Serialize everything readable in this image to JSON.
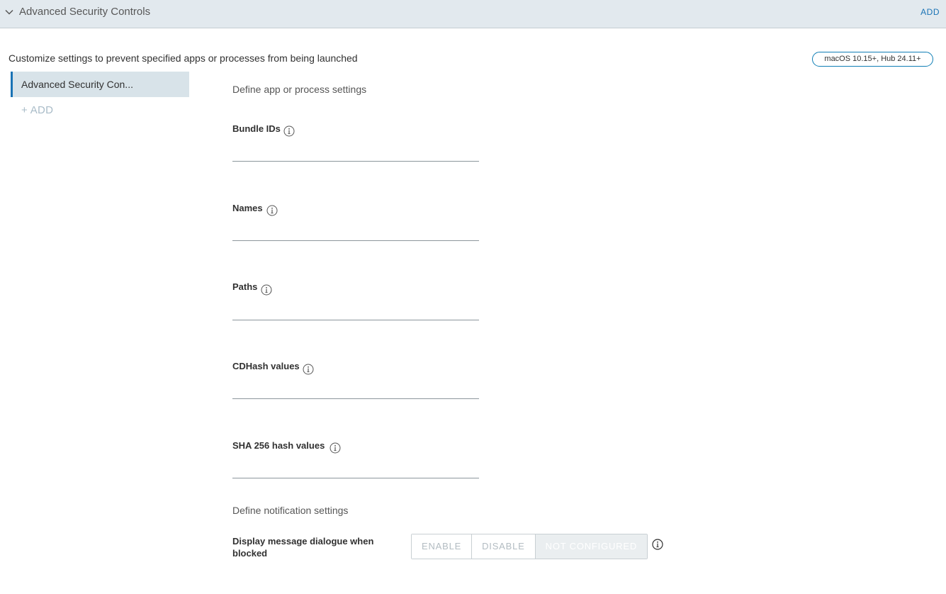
{
  "header": {
    "title": "Advanced Security Controls",
    "add_label": "ADD"
  },
  "description": "Customize settings to prevent specified apps or processes from being launched",
  "version_badge": "macOS 10.15+, Hub 24.11+",
  "sidebar": {
    "items": [
      {
        "label": "Advanced Security Con..."
      }
    ],
    "add_label": "+ ADD"
  },
  "app_section": {
    "heading": "Define app or process settings",
    "fields": [
      {
        "label": "Bundle IDs",
        "value": ""
      },
      {
        "label": "Names",
        "value": ""
      },
      {
        "label": "Paths",
        "value": ""
      },
      {
        "label": "CDHash values",
        "value": ""
      },
      {
        "label": "SHA 256 hash values",
        "value": ""
      }
    ]
  },
  "notification_section": {
    "heading": "Define notification settings",
    "display_message": {
      "label": "Display message dialogue when blocked",
      "options": [
        "ENABLE",
        "DISABLE",
        "NOT CONFIGURED"
      ],
      "selected": "NOT CONFIGURED"
    }
  },
  "icons": {
    "collapse": "chevron-down-icon",
    "info": "info-icon"
  },
  "colors": {
    "accent": "#1a73b5",
    "header_bg": "#e2e9ee",
    "sidebar_selected_bg": "#d8e3e9"
  }
}
